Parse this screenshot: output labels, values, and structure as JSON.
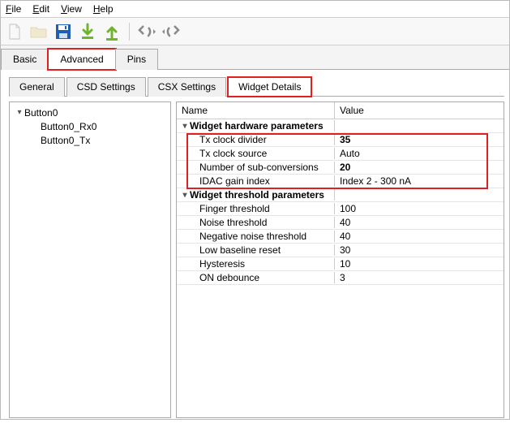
{
  "menu": {
    "file": "File",
    "edit": "Edit",
    "view": "View",
    "help": "Help"
  },
  "tabs1": {
    "basic": "Basic",
    "advanced": "Advanced",
    "pins": "Pins"
  },
  "tabs2": {
    "general": "General",
    "csd": "CSD Settings",
    "csx": "CSX Settings",
    "widget": "Widget Details"
  },
  "tree": {
    "root": "Button0",
    "rx": "Button0_Rx0",
    "tx": "Button0_Tx"
  },
  "props_header": {
    "name": "Name",
    "value": "Value"
  },
  "groups": {
    "hw": "Widget hardware parameters",
    "th": "Widget threshold parameters"
  },
  "hw": {
    "txdiv_l": "Tx clock divider",
    "txdiv_v": "35",
    "txsrc_l": "Tx clock source",
    "txsrc_v": "Auto",
    "subc_l": "Number of sub-conversions",
    "subc_v": "20",
    "idac_l": "IDAC gain index",
    "idac_v": "Index 2 - 300 nA"
  },
  "th": {
    "finger_l": "Finger threshold",
    "finger_v": "100",
    "noise_l": "Noise threshold",
    "noise_v": "40",
    "neg_l": "Negative noise threshold",
    "neg_v": "40",
    "lowb_l": "Low baseline reset",
    "lowb_v": "30",
    "hyst_l": "Hysteresis",
    "hyst_v": "10",
    "ond_l": "ON debounce",
    "ond_v": "3"
  }
}
